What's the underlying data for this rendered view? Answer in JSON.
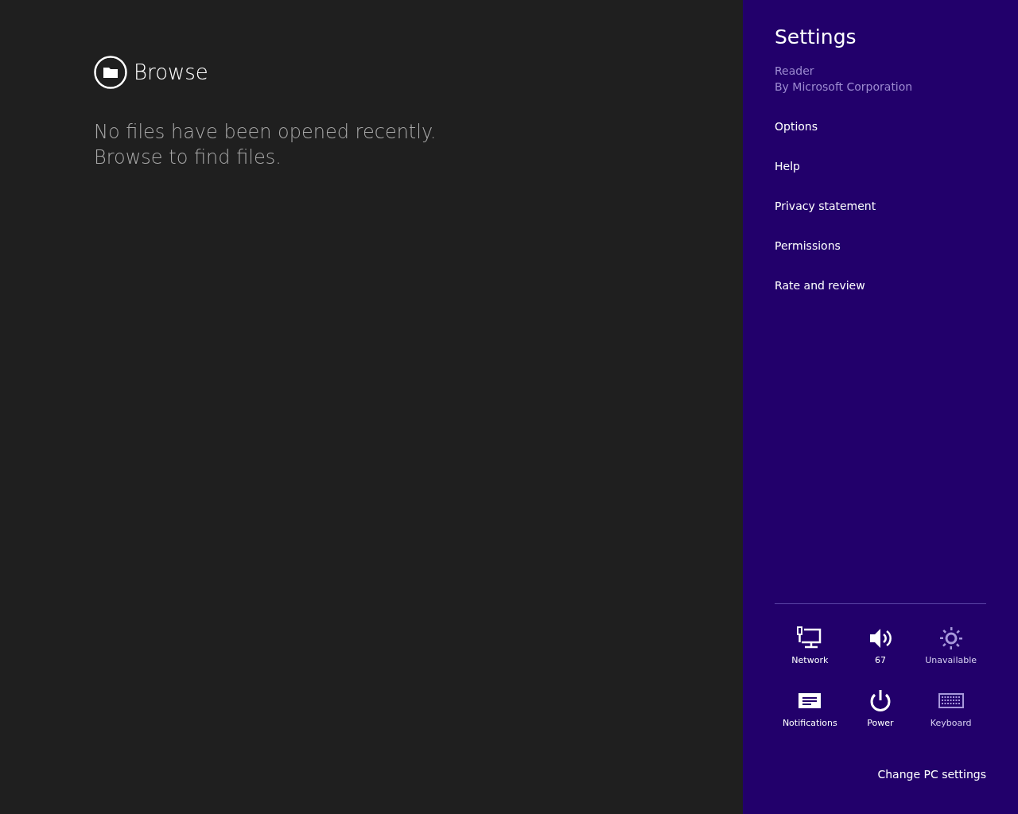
{
  "browse": {
    "title": "Browse",
    "message": [
      "No files have been opened recently.",
      "Browse to find files."
    ]
  },
  "settings": {
    "title": "Settings",
    "app_name": "Reader",
    "publisher": "By Microsoft Corporation",
    "items": [
      "Options",
      "Help",
      "Privacy statement",
      "Permissions",
      "Rate and review"
    ],
    "tiles": [
      {
        "kind": "network",
        "label": "Network",
        "disabled": false
      },
      {
        "kind": "volume",
        "label": "67",
        "disabled": false
      },
      {
        "kind": "brightness",
        "label": "Unavailable",
        "disabled": true
      },
      {
        "kind": "notifications",
        "label": "Notifications",
        "disabled": false
      },
      {
        "kind": "power",
        "label": "Power",
        "disabled": false
      },
      {
        "kind": "keyboard",
        "label": "Keyboard",
        "disabled": true
      }
    ],
    "footer_link": "Change PC settings"
  }
}
